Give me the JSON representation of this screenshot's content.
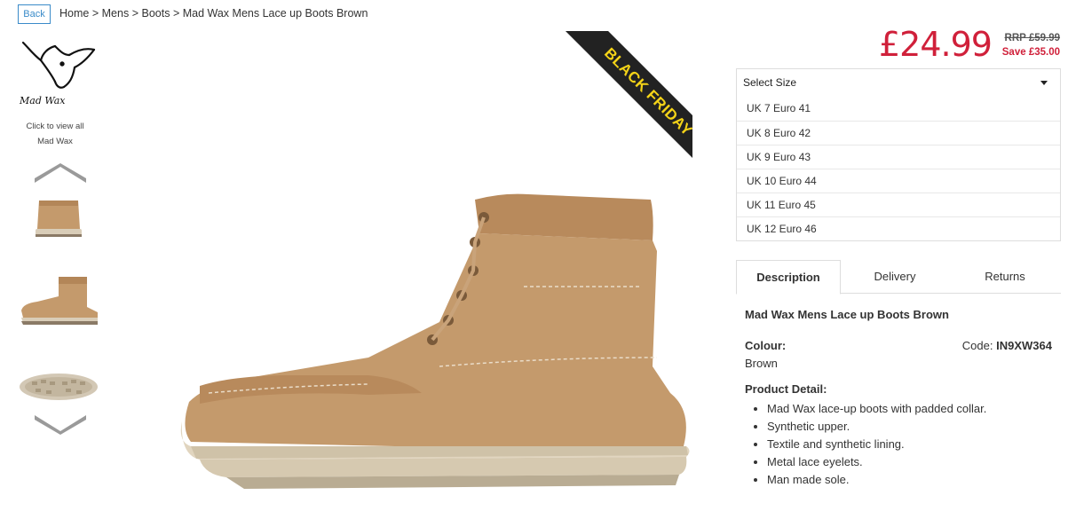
{
  "nav": {
    "back_label": "Back",
    "breadcrumb": [
      "Home",
      "Mens",
      "Boots",
      "Mad Wax Mens Lace up Boots Brown"
    ],
    "separator": ">"
  },
  "brand": {
    "logo_text": "Mad Wax",
    "caption_line1": "Click to view all",
    "caption_line2": "Mad Wax"
  },
  "promo": {
    "ribbon_text": "BLACK FRIDAY",
    "ribbon_bg": "#222222",
    "ribbon_fg": "#f4d318"
  },
  "pricing": {
    "price": "£24.99",
    "rrp": "RRP £59.99",
    "save": "Save £35.00",
    "price_color": "#d0203a"
  },
  "size": {
    "placeholder": "Select Size",
    "options": [
      "UK 7 Euro 41",
      "UK 8 Euro 42",
      "UK 9 Euro 43",
      "UK 10 Euro 44",
      "UK 11 Euro 45",
      "UK 12 Euro 46"
    ]
  },
  "tabs": {
    "description": "Description",
    "delivery": "Delivery",
    "returns": "Returns"
  },
  "product": {
    "title": "Mad Wax Mens Lace up Boots Brown",
    "colour_label": "Colour:",
    "colour_value": "Brown",
    "code_label": "Code:",
    "code_value": "IN9XW364",
    "detail_label": "Product Detail:",
    "details": [
      "Mad Wax lace-up boots with padded collar.",
      "Synthetic upper.",
      "Textile and synthetic lining.",
      "Metal lace eyelets.",
      "Man made sole."
    ]
  }
}
